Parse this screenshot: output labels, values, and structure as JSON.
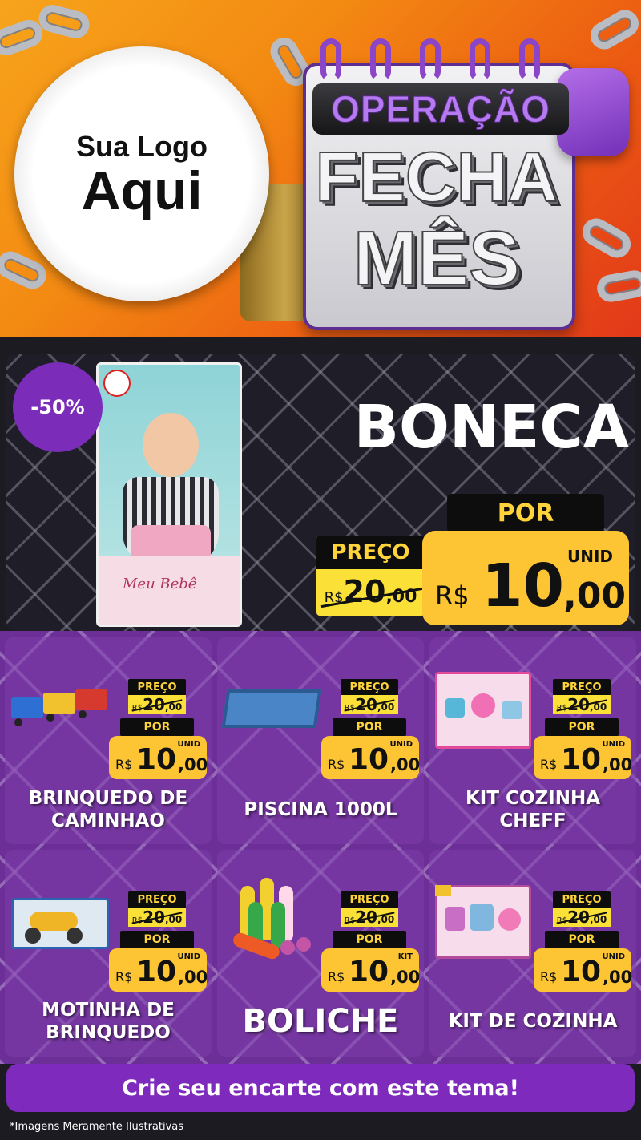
{
  "header": {
    "logo_line1": "Sua Logo",
    "logo_line2": "Aqui",
    "campaign_line1": "OPERAÇÃO",
    "campaign_line2": "FECHA",
    "campaign_line3": "MÊS"
  },
  "featured": {
    "discount": "-50%",
    "name": "BONECA",
    "preco_label": "PREÇO",
    "old_currency": "R$",
    "old_int": "20",
    "old_dec": ",00",
    "por_label": "POR",
    "unit": "UNID",
    "new_currency": "R$",
    "new_int": "10",
    "new_dec": ",00",
    "box_brand": "Meu Bebê"
  },
  "products": [
    {
      "name": "BRINQUEDO DE CAMINHAO",
      "preco_label": "PREÇO",
      "old_currency": "R$",
      "old_int": "20",
      "old_dec": ",00",
      "por_label": "POR",
      "unit": "UNID",
      "new_currency": "R$",
      "new_int": "10",
      "new_dec": ",00"
    },
    {
      "name": "PISCINA 1000L",
      "preco_label": "PREÇO",
      "old_currency": "R$",
      "old_int": "20",
      "old_dec": ",00",
      "por_label": "POR",
      "unit": "UNID",
      "new_currency": "R$",
      "new_int": "10",
      "new_dec": ",00"
    },
    {
      "name": "KIT COZINHA CHEFF",
      "preco_label": "PREÇO",
      "old_currency": "R$",
      "old_int": "20",
      "old_dec": ",00",
      "por_label": "POR",
      "unit": "UNID",
      "new_currency": "R$",
      "new_int": "10",
      "new_dec": ",00"
    },
    {
      "name": "MOTINHA DE BRINQUEDO",
      "preco_label": "PREÇO",
      "old_currency": "R$",
      "old_int": "20",
      "old_dec": ",00",
      "por_label": "POR",
      "unit": "UNID",
      "new_currency": "R$",
      "new_int": "10",
      "new_dec": ",00"
    },
    {
      "name": "BOLICHE",
      "preco_label": "PREÇO",
      "old_currency": "R$",
      "old_int": "20",
      "old_dec": ",00",
      "por_label": "POR",
      "unit": "KIT",
      "new_currency": "R$",
      "new_int": "10",
      "new_dec": ",00"
    },
    {
      "name": "KIT DE COZINHA",
      "preco_label": "PREÇO",
      "old_currency": "R$",
      "old_int": "20",
      "old_dec": ",00",
      "por_label": "POR",
      "unit": "UNID",
      "new_currency": "R$",
      "new_int": "10",
      "new_dec": ",00"
    }
  ],
  "footer": {
    "cta": "Crie seu encarte com este tema!",
    "disclaimer": "*Imagens Meramente Ilustrativas"
  },
  "colors": {
    "purple": "#7e2bbd",
    "yellow": "#fdc534",
    "price_label_text": "#ffd43b",
    "orange": "#f38a12"
  }
}
